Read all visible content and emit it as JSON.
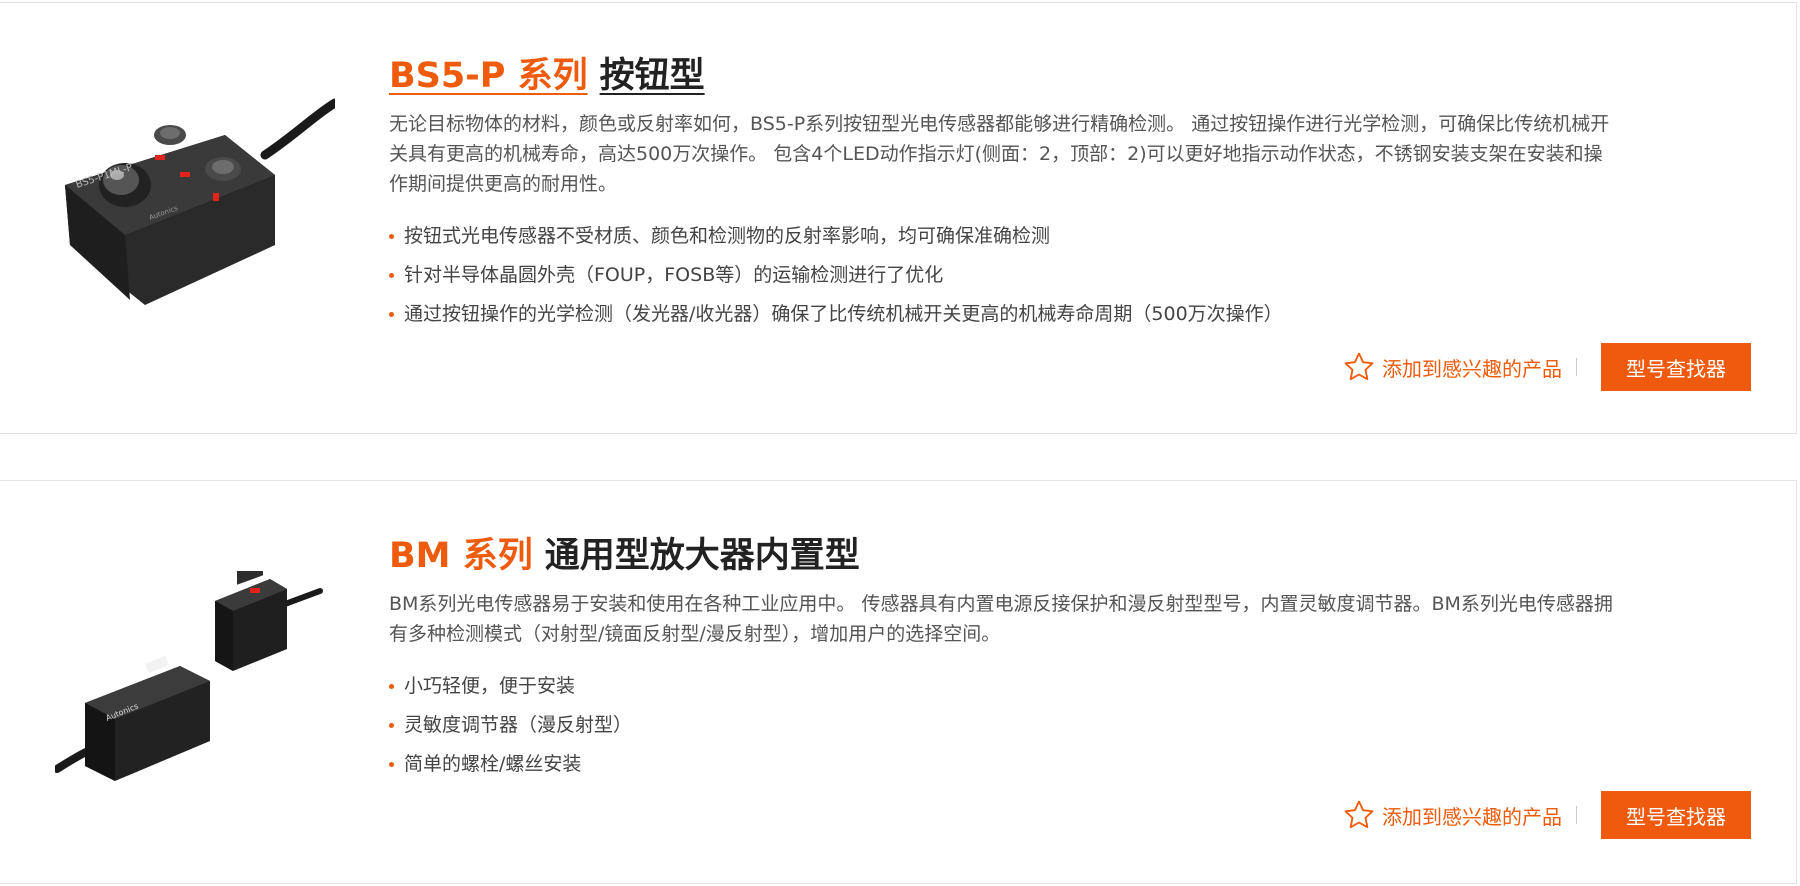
{
  "products": [
    {
      "series": "BS5-P 系列",
      "type": "按钮型",
      "description": "无论目标物体的材料，颜色或反射率如何，BS5-P系列按钮型光电传感器都能够进行精确检测。 通过按钮操作进行光学检测，可确保比传统机械开关具有更高的机械寿命，高达500万次操作。 包含4个LED动作指示灯(侧面：2，顶部：2)可以更好地指示动作状态，不锈钢安装支架在安装和操作期间提供更高的耐用性。",
      "features": [
        "按钮式光电传感器不受材质、颜色和检测物的反射率影响，均可确保准确检测",
        "针对半导体晶圆外壳（FOUP，FOSB等）的运输检测进行了优化",
        "通过按钮操作的光学检测（发光器/收光器）确保了比传统机械开关更高的机械寿命周期（500万次操作）"
      ],
      "favorite_label": "添加到感兴趣的产品",
      "finder_label": "型号查找器",
      "image_text": "BS5-P1ML-P",
      "image_brand": "Autonics"
    },
    {
      "series": "BM 系列",
      "type": "通用型放大器内置型",
      "description": "BM系列光电传感器易于安装和使用在各种工业应用中。 传感器具有内置电源反接保护和漫反射型型号，内置灵敏度调节器。BM系列光电传感器拥有多种检测模式（对射型/镜面反射型/漫反射型），增加用户的选择空间。",
      "features": [
        "小巧轻便，便于安装",
        "灵敏度调节器（漫反射型）",
        "简单的螺栓/螺丝安装"
      ],
      "favorite_label": "添加到感兴趣的产品",
      "finder_label": "型号查找器",
      "image_brand": "Autonics"
    }
  ],
  "colors": {
    "accent": "#ef5b0c",
    "button": "#f05a0e",
    "border": "#e3e3e3"
  }
}
